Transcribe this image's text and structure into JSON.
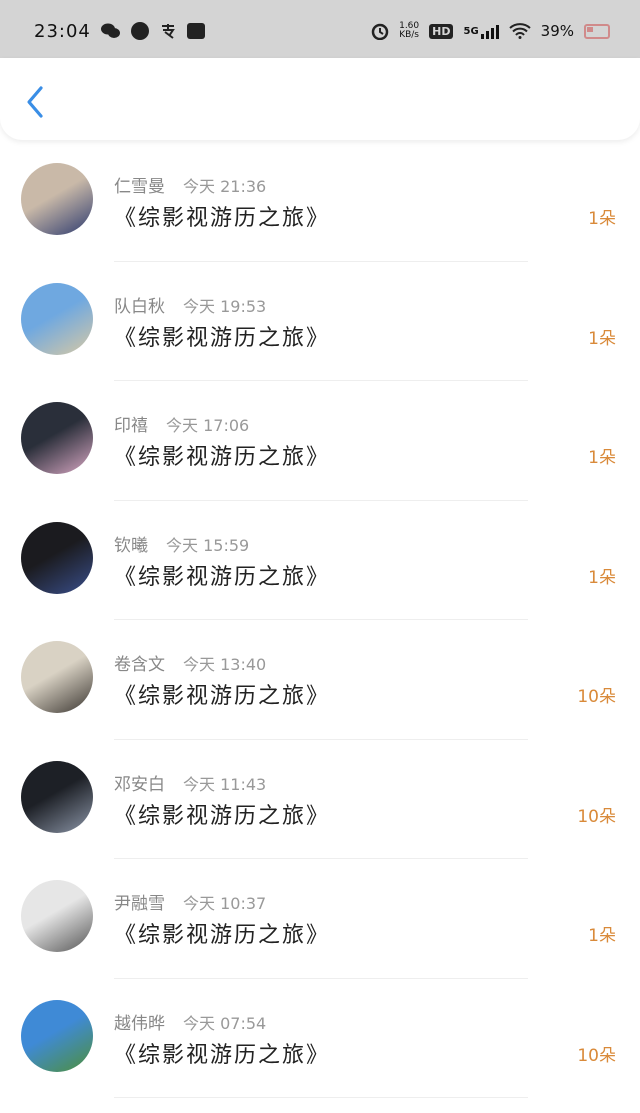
{
  "status_bar": {
    "time": "23:04",
    "net_speed_value": "1.60",
    "net_speed_unit": "KB/s",
    "hd": "HD",
    "network": "5G",
    "battery": "39%"
  },
  "header": {
    "back_icon": "chevron-left-icon"
  },
  "colors": {
    "accent": "#3a8ee6",
    "amount": "#d98a3a"
  },
  "gifts": [
    {
      "name": "仁雪曼",
      "time": "今天 21:36",
      "book": "《综影视游历之旅》",
      "amount": "1朵",
      "avatar_palette": [
        "#c9b9a8",
        "#2d3a6e"
      ]
    },
    {
      "name": "队白秋",
      "time": "今天 19:53",
      "book": "《综影视游历之旅》",
      "amount": "1朵",
      "avatar_palette": [
        "#6fa8e0",
        "#d8c9a4"
      ]
    },
    {
      "name": "印禧",
      "time": "今天 17:06",
      "book": "《综影视游历之旅》",
      "amount": "1朵",
      "avatar_palette": [
        "#2a2f3a",
        "#d9a8c4"
      ]
    },
    {
      "name": "钦曦",
      "time": "今天 15:59",
      "book": "《综影视游历之旅》",
      "amount": "1朵",
      "avatar_palette": [
        "#1b1b1f",
        "#3a4f8c"
      ]
    },
    {
      "name": "卷含文",
      "time": "今天 13:40",
      "book": "《综影视游历之旅》",
      "amount": "10朵",
      "avatar_palette": [
        "#d9d2c4",
        "#3a3530"
      ]
    },
    {
      "name": "邓安白",
      "time": "今天 11:43",
      "book": "《综影视游历之旅》",
      "amount": "10朵",
      "avatar_palette": [
        "#1d2026",
        "#8c96a8"
      ]
    },
    {
      "name": "尹融雪",
      "time": "今天 10:37",
      "book": "《综影视游历之旅》",
      "amount": "1朵",
      "avatar_palette": [
        "#e6e6e6",
        "#555555"
      ]
    },
    {
      "name": "越伟晔",
      "time": "今天 07:54",
      "book": "《综影视游历之旅》",
      "amount": "10朵",
      "avatar_palette": [
        "#3f8ad6",
        "#4e8f3a"
      ]
    }
  ]
}
